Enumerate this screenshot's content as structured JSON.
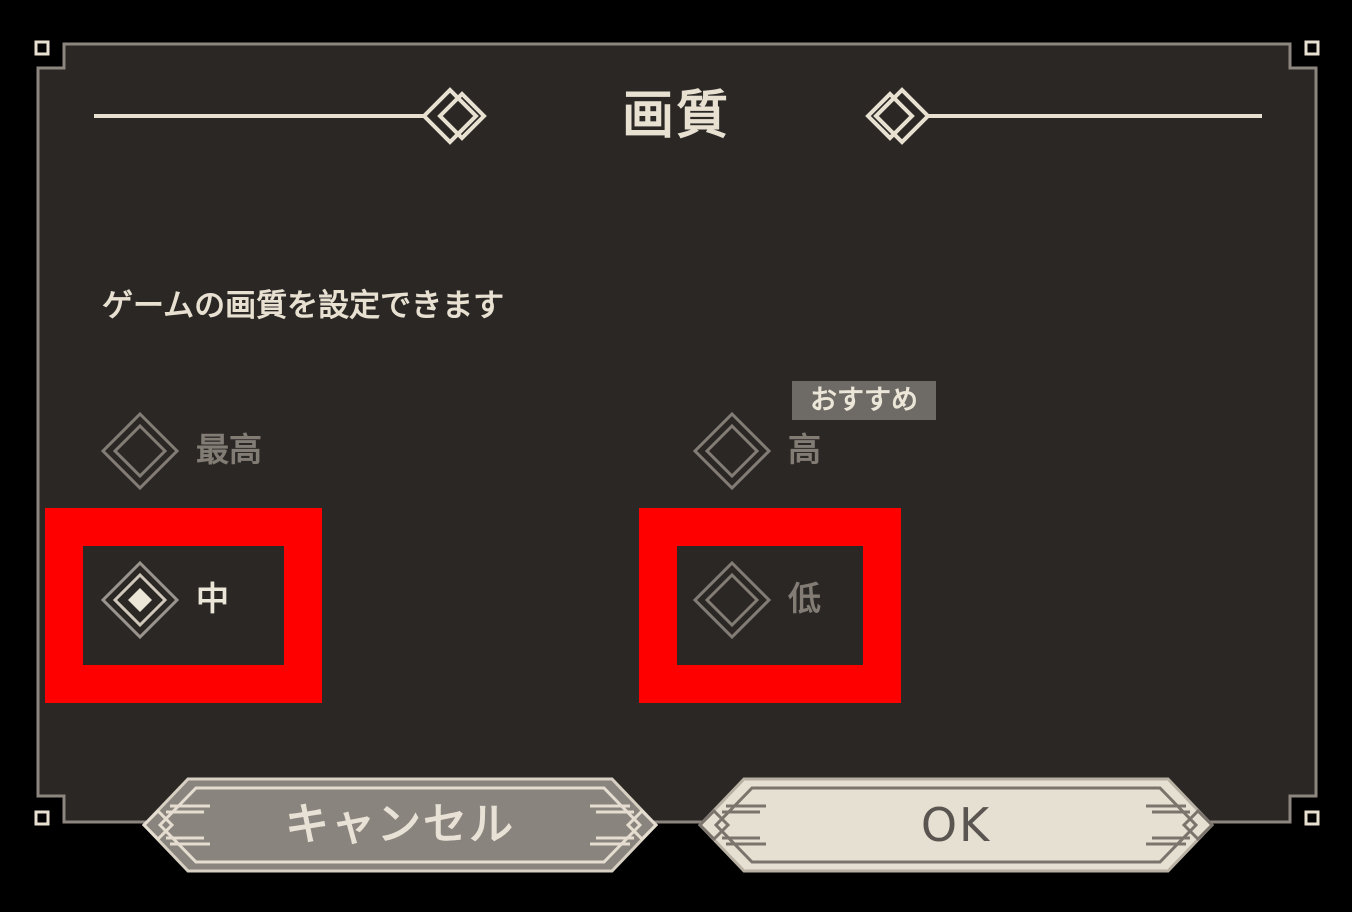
{
  "dialog": {
    "title": "画質",
    "subtitle": "ゲームの画質を設定できます"
  },
  "options": [
    {
      "id": "highest",
      "label": "最高",
      "selected": false
    },
    {
      "id": "high",
      "label": "高",
      "selected": false,
      "badge": "おすすめ"
    },
    {
      "id": "medium",
      "label": "中",
      "selected": true
    },
    {
      "id": "low",
      "label": "低",
      "selected": false
    }
  ],
  "buttons": {
    "cancel_label": "キャンセル",
    "ok_label": "OK"
  },
  "colors": {
    "panel_bg": "#2a2725",
    "frame_line": "#8c867f",
    "text_light": "#e8e1d2",
    "text_disabled": "#827c75",
    "badge_bg": "#6e6a66",
    "highlight": "#ff0000",
    "cancel_bg": "#8a847e",
    "ok_bg": "#e6e0d2"
  }
}
